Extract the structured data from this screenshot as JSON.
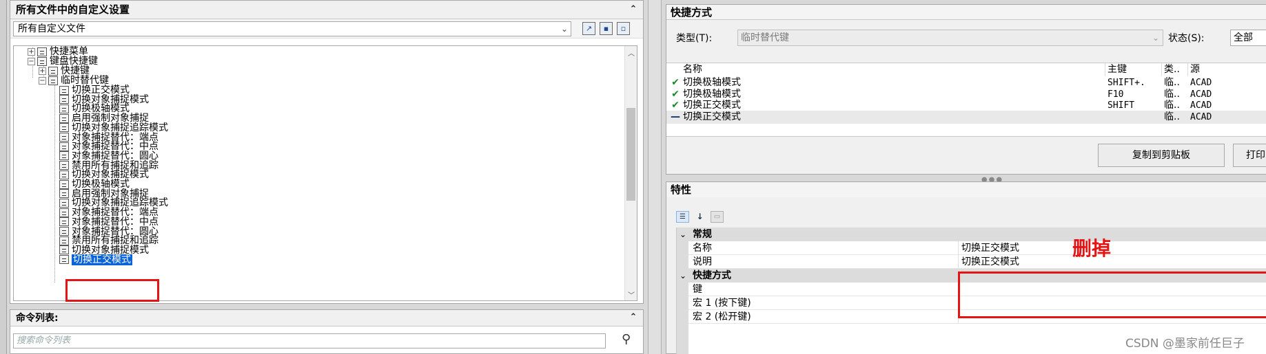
{
  "left": {
    "title": "所有文件中的自定义设置",
    "file_select": "所有自定义文件",
    "tool_icons": [
      "open-file-icon",
      "save-icon",
      "save-as-icon"
    ],
    "tree": {
      "quick_menu": "快捷菜单",
      "keyboard_shortcuts": "键盘快捷键",
      "shortcut_keys": "快捷键",
      "temp_override_keys": "临时替代键",
      "items": [
        "切换正交模式",
        "切换对象捕捉模式",
        "切换极轴模式",
        "启用强制对象捕捉",
        "切换对象捕捉追踪模式",
        "对象捕捉替代：端点",
        "对象捕捉替代：中点",
        "对象捕捉替代：圆心",
        "禁用所有捕捉和追踪",
        "切换对象捕捉模式",
        "切换极轴模式",
        "启用强制对象捕捉",
        "切换对象捕捉追踪模式",
        "对象捕捉替代：端点",
        "对象捕捉替代：中点",
        "对象捕捉替代：圆心",
        "禁用所有捕捉和追踪",
        "切换对象捕捉模式",
        "切换正交模式"
      ]
    }
  },
  "command_list": {
    "title": "命令列表:",
    "search_placeholder": "搜索命令列表"
  },
  "shortcuts": {
    "title": "快捷方式",
    "type_label": "类型(T):",
    "type_value": "临时替代键",
    "status_label": "状态(S):",
    "status_value": "全部",
    "columns": {
      "name": "名称",
      "key": "主键",
      "type": "类..",
      "source": "源"
    },
    "rows": [
      {
        "check": "✔",
        "name": "切换极轴模式",
        "key": "SHIFT+.",
        "type": "临..",
        "source": "ACAD"
      },
      {
        "check": "✔",
        "name": "切换极轴模式",
        "key": "F10",
        "type": "临..",
        "source": "ACAD"
      },
      {
        "check": "✔",
        "name": "切换正交模式",
        "key": "SHIFT",
        "type": "临..",
        "source": "ACAD"
      },
      {
        "check": "—",
        "name": "切换正交模式",
        "key": "",
        "type": "临..",
        "source": "ACAD"
      }
    ],
    "copy_button": "复制到剪贴板",
    "print_button": "打印"
  },
  "properties": {
    "title": "特性",
    "general_category": "常规",
    "name_label": "名称",
    "name_value": "切换正交模式",
    "desc_label": "说明",
    "desc_value": "切换正交模式",
    "shortcut_category": "快捷方式",
    "key_label": "键",
    "macro1_label": "宏 1 (按下键)",
    "macro2_label": "宏 2 (松开键)"
  },
  "annotation": {
    "delete_note": "删掉",
    "color": "#e51414"
  },
  "watermark": "CSDN @墨家前任巨子",
  "colors": {
    "selection": "#0a64d8",
    "check_green": "#1a8a2a"
  }
}
